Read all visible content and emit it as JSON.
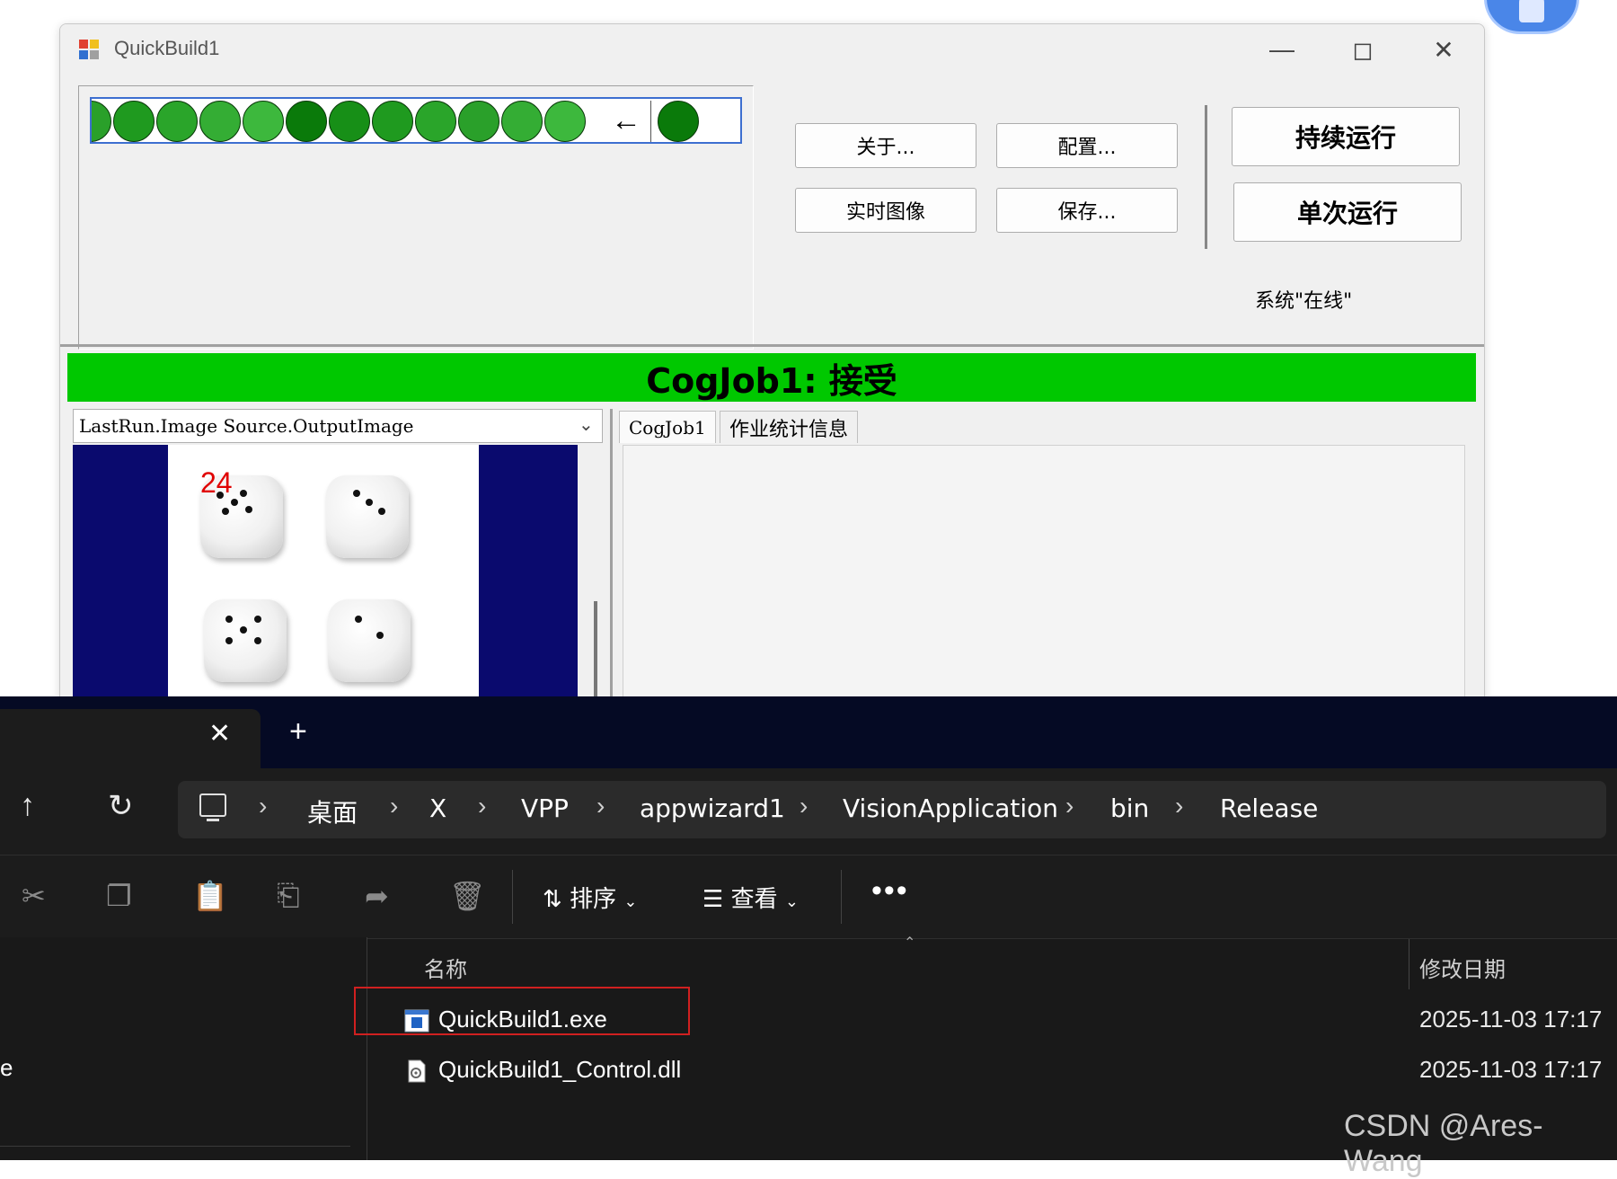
{
  "quickbuild": {
    "title": "QuickBuild1",
    "buttons": {
      "about": "关于...",
      "config": "配置...",
      "live_image": "实时图像",
      "save": "保存...",
      "run_continuous": "持续运行",
      "run_once": "单次运行"
    },
    "system_status": "系统\"在线\"",
    "job_status": "CogJob1: 接受",
    "status_color": "#00c800",
    "run_history_dot_color": "#2aa02a",
    "image_selector": "LastRun.Image Source.OutputImage",
    "image_overlay_count": "24",
    "tabs": [
      "CogJob1",
      "作业统计信息"
    ]
  },
  "explorer": {
    "breadcrumb": [
      "桌面",
      "X",
      "VPP",
      "appwizard1",
      "VisionApplication",
      "bin",
      "Release"
    ],
    "toolbar": {
      "sort": "排序",
      "view": "查看",
      "more": "•••"
    },
    "columns": {
      "name": "名称",
      "modified": "修改日期"
    },
    "files": [
      {
        "name": "QuickBuild1.exe",
        "modified": "2025-11-03 17:17",
        "icon": "exe-icon"
      },
      {
        "name": "QuickBuild1_Control.dll",
        "modified": "2025-11-03 17:17",
        "icon": "dll-icon"
      }
    ],
    "nav_pane_fragment": "e"
  },
  "watermark": "CSDN @Ares-Wang"
}
